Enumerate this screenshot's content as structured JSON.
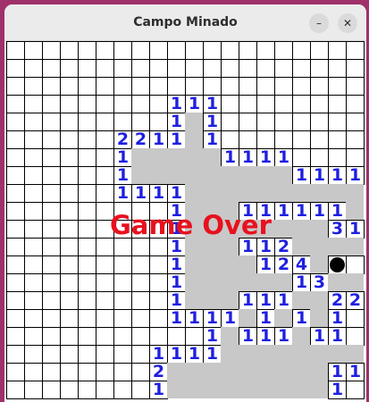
{
  "window": {
    "title": "Campo Minado",
    "minimize_label": "–",
    "close_label": "✕"
  },
  "game": {
    "status_message": "Game Over",
    "rows": 20,
    "cols": 20,
    "mine_color": "#000000",
    "number_color": "#1f1fe0",
    "message_color": "#e8111e",
    "revealed_color": "#c8c8c8",
    "grid": [
      "....................",
      "....................",
      "....................",
      ".........111........",
      ".........1o1........",
      "......2211o1........",
      "......1ooooo1111....",
      "......1ooooooooo111111",
      "......1111oooooooooo",
      ".........1ooo111111o",
      ".........1oooooooo31",
      ".........1ooo112oooo",
      ".........1oooo124oM",
      ".........1oooooo13oo",
      ".........1ooo111oo22",
      ".........1111o1o1o1.",
      "...........1o111o11.",
      "........1111oooooooo",
      "........2ooooooooo11",
      "........1ooooooooo1."
    ]
  }
}
